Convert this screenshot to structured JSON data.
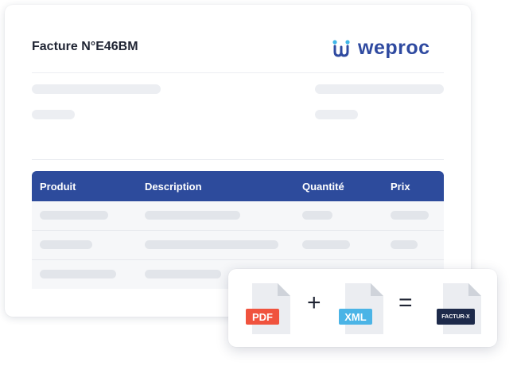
{
  "invoice": {
    "title": "Facture N°E46BM"
  },
  "brand": {
    "name": "weproc",
    "icon": "weproc-logo-icon",
    "color": "#2f4aa0"
  },
  "table": {
    "header_color": "#2d4b9c",
    "columns": [
      "Produit",
      "Description",
      "Quantité",
      "Prix"
    ]
  },
  "combo": {
    "pdf_label": "PDF",
    "plus": "+",
    "xml_label": "XML",
    "equals": "=",
    "facturx_label": "FACTUR-X",
    "colors": {
      "pdf": "#f0533e",
      "xml": "#4bb4e6",
      "facturx": "#1d2a4a"
    }
  }
}
